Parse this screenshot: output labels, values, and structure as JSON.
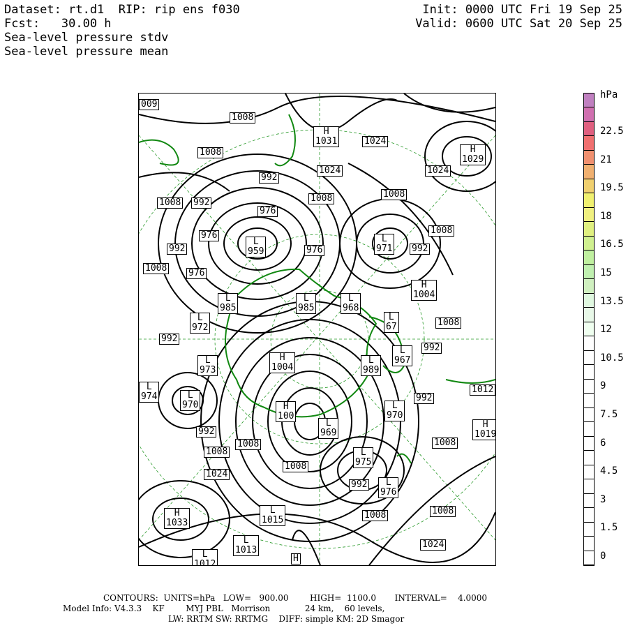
{
  "header": {
    "dataset_line": "Dataset: rt.d1  RIP: rip ens f030",
    "fcst_line": "Fcst:   30.00 h",
    "field1": "Sea-level pressure stdv",
    "field2": "Sea-level pressure mean",
    "init_line": "Init: 0000 UTC Fri 19 Sep 25",
    "valid_line": "Valid: 0600 UTC Sat 20 Sep 25"
  },
  "colorbar": {
    "unit": "hPa",
    "ticks": [
      "22.5",
      "21",
      "19.5",
      "18",
      "16.5",
      "15",
      "13.5",
      "12",
      "10.5",
      "9",
      "7.5",
      "6",
      "4.5",
      "3",
      "1.5",
      "0"
    ],
    "colors": [
      "#c080c0",
      "#d070b0",
      "#e06080",
      "#f07070",
      "#f09070",
      "#f0b070",
      "#f0d070",
      "#f0f070",
      "#f0f080",
      "#e0f080",
      "#d0f090",
      "#c0f0a0",
      "#c0f0b0",
      "#d0f0c0",
      "#e0f8e0",
      "#e8f8e8",
      "#f0fff0",
      "#ffffff",
      "#ffffff",
      "#ffffff",
      "#ffffff",
      "#ffffff",
      "#ffffff",
      "#ffffff",
      "#ffffff",
      "#ffffff",
      "#ffffff",
      "#ffffff",
      "#ffffff",
      "#ffffff",
      "#ffffff",
      "#ffffff",
      "#ffffff"
    ]
  },
  "map": {
    "labels": [
      {
        "t": "009"
      },
      {
        "t": "1008"
      },
      {
        "t": "H\n1031"
      },
      {
        "t": "1024"
      },
      {
        "t": "H\n1029"
      },
      {
        "t": "1008"
      },
      {
        "t": "992"
      },
      {
        "t": "1024"
      },
      {
        "t": "1024"
      },
      {
        "t": "1008"
      },
      {
        "t": "992"
      },
      {
        "t": "1008"
      },
      {
        "t": "1008"
      },
      {
        "t": "976"
      },
      {
        "t": "976"
      },
      {
        "t": "L\n959"
      },
      {
        "t": "976"
      },
      {
        "t": "L\n971"
      },
      {
        "t": "992"
      },
      {
        "t": "1008"
      },
      {
        "t": "992"
      },
      {
        "t": "1008"
      },
      {
        "t": "976"
      },
      {
        "t": "H\n1004"
      },
      {
        "t": "L\n985"
      },
      {
        "t": "L\n985"
      },
      {
        "t": "L\n968"
      },
      {
        "t": "L\n972"
      },
      {
        "t": "L\n67"
      },
      {
        "t": "1008"
      },
      {
        "t": "992"
      },
      {
        "t": "L\n967"
      },
      {
        "t": "992"
      },
      {
        "t": "L\n973"
      },
      {
        "t": "H\n1004"
      },
      {
        "t": "L\n989"
      },
      {
        "t": "L\n974"
      },
      {
        "t": "L\n970"
      },
      {
        "t": "H\n100"
      },
      {
        "t": "992"
      },
      {
        "t": "L\n970"
      },
      {
        "t": "1012"
      },
      {
        "t": "992"
      },
      {
        "t": "L\n969"
      },
      {
        "t": "H\n1019"
      },
      {
        "t": "1008"
      },
      {
        "t": "1008"
      },
      {
        "t": "1008"
      },
      {
        "t": "L\n975"
      },
      {
        "t": "1008"
      },
      {
        "t": "1024"
      },
      {
        "t": "992"
      },
      {
        "t": "L\n976"
      },
      {
        "t": "H\n1033"
      },
      {
        "t": "L\n1015"
      },
      {
        "t": "1008"
      },
      {
        "t": "1008"
      },
      {
        "t": "L\n1013"
      },
      {
        "t": "1024"
      },
      {
        "t": "L\n1012"
      },
      {
        "t": "H"
      }
    ]
  },
  "footer": {
    "line1": "CONTOURS:  UNITS=hPa   LOW=   900.00        HIGH=  1100.0       INTERVAL=    4.0000",
    "line2": "Model Info: V4.3.3    KF        MYJ PBL   Morrison             24 km,    60 levels,",
    "line3": "LW: RRTM SW: RRTMG    DIFF: simple KM: 2D Smagor"
  }
}
